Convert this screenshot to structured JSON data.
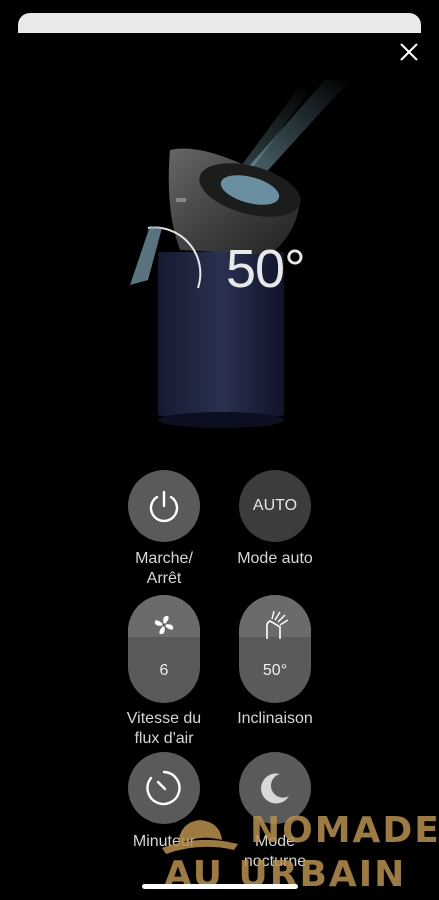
{
  "header": {
    "close_icon": "close-icon"
  },
  "device": {
    "tilt_value": "50°"
  },
  "controls": {
    "power": {
      "label": "Marche/\nArrêt",
      "icon": "power-icon"
    },
    "auto": {
      "button_text": "AUTO",
      "label": "Mode auto"
    },
    "fan": {
      "value": "6",
      "label": "Vitesse du\nflux d'air",
      "icon": "fan-icon"
    },
    "tilt": {
      "value": "50°",
      "label": "Inclinaison",
      "icon": "tilt-icon"
    },
    "timer": {
      "label": "Minuteur",
      "icon": "timer-icon"
    },
    "night": {
      "label": "Mode\nnocturne",
      "icon": "moon-icon"
    }
  },
  "watermark": {
    "line1": "NOMADE",
    "line2": "AU URBAIN"
  },
  "colors": {
    "background": "#000000",
    "button": "#5a5a5a",
    "watermark": "#b9904a"
  }
}
